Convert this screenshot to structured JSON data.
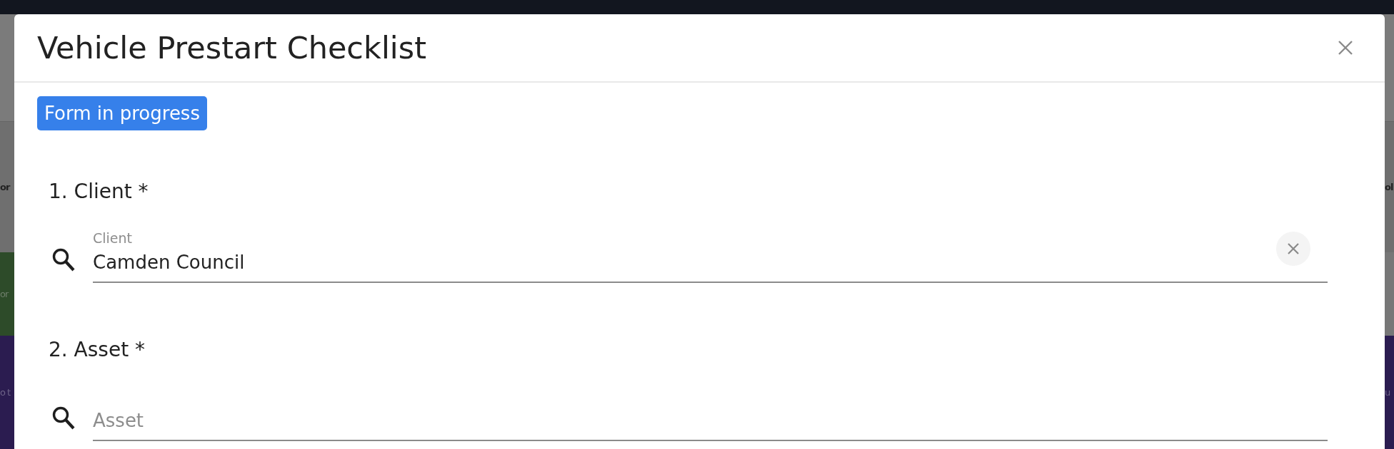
{
  "background": {
    "left_fragments": [
      {
        "text": "or",
        "kind": "heading"
      },
      {
        "text": "or",
        "kind": "green"
      },
      {
        "text": "o t",
        "kind": "purple"
      }
    ],
    "right_fragments": [
      {
        "text": "ol",
        "kind": "heading"
      },
      {
        "text": "u",
        "kind": "purple"
      }
    ]
  },
  "dialog": {
    "title": "Vehicle Prestart Checklist",
    "status_badge": "Form in progress",
    "questions": [
      {
        "label": "1. Client *",
        "field_label": "Client",
        "value": "Camden Council",
        "clearable": true
      },
      {
        "label": "2. Asset *",
        "placeholder": "Asset",
        "clearable": false
      }
    ]
  }
}
